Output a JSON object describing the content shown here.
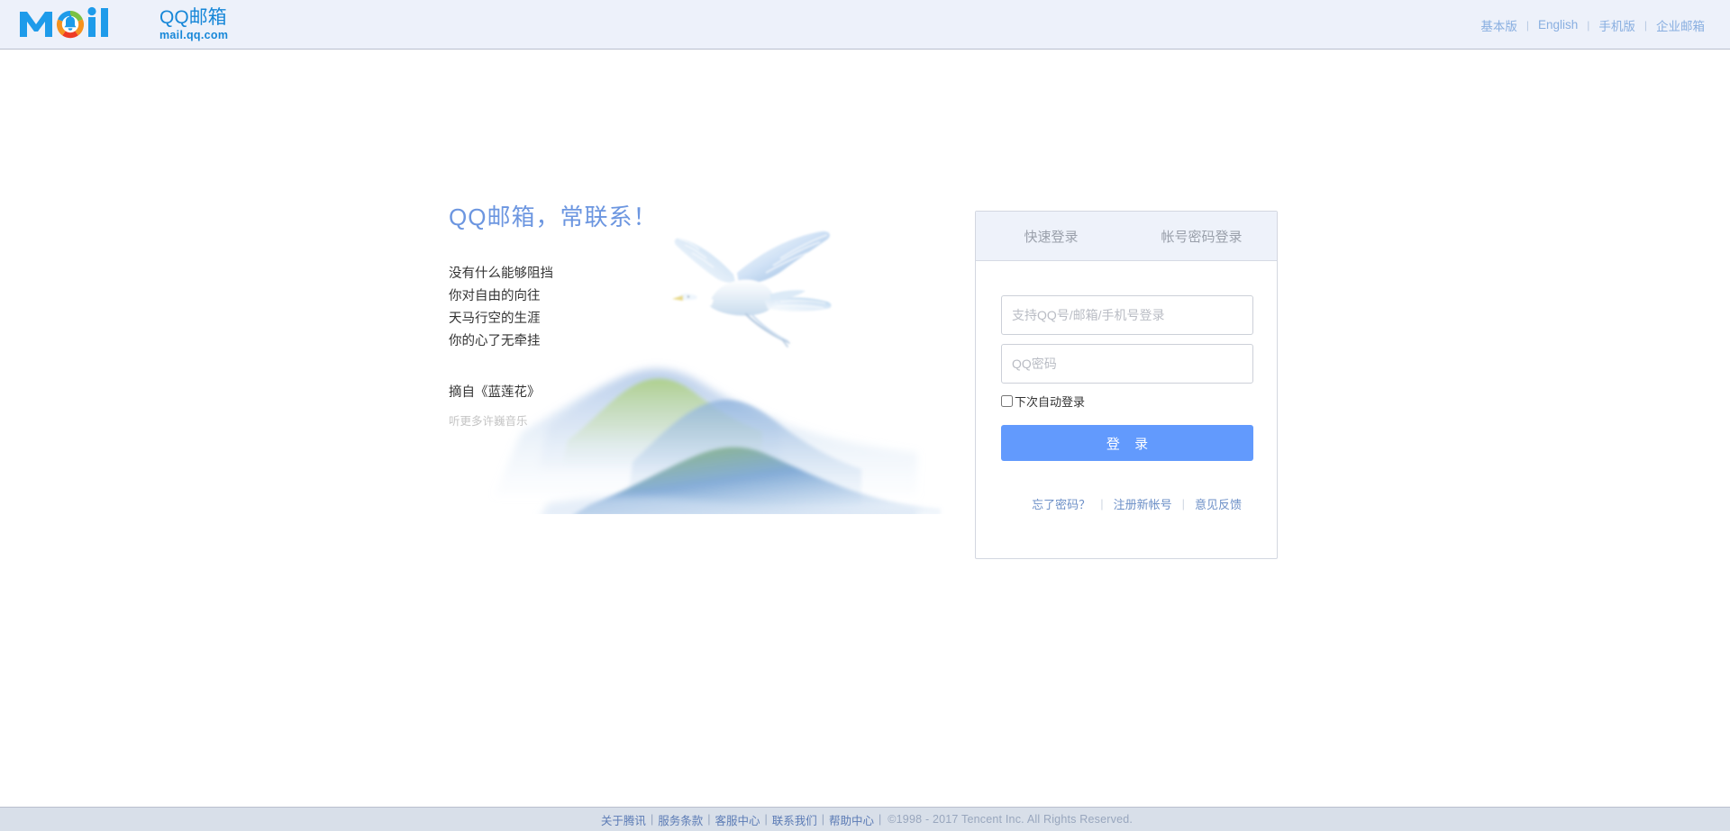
{
  "header": {
    "logo": {
      "mark_icon": "qqmail-logo-icon",
      "wordmark": "Mail",
      "title": "QQ邮箱",
      "subtitle": "mail.qq.com"
    },
    "links": [
      {
        "label": "基本版"
      },
      {
        "label": "English"
      },
      {
        "label": "手机版"
      },
      {
        "label": "企业邮箱"
      }
    ],
    "separator": "|",
    "bg_color": "#edf1fa",
    "link_color": "#88aee0"
  },
  "promo": {
    "title": "QQ邮箱，常联系！",
    "title_color": "#6c96e0",
    "lines": [
      "没有什么能够阻挡",
      "你对自由的向往",
      "天马行空的生涯",
      "你的心了无牵挂"
    ],
    "source": "摘自《蓝莲花》",
    "music_link": "听更多许巍音乐",
    "art": {
      "crane_icon": "flying-crane-icon",
      "mountains_icon": "watercolor-mountains-icon"
    }
  },
  "login": {
    "tabs": [
      {
        "label": "快速登录",
        "active": true
      },
      {
        "label": "帐号密码登录",
        "active": false
      }
    ],
    "account": {
      "value": "",
      "placeholder": "支持QQ号/邮箱/手机号登录"
    },
    "password": {
      "value": "",
      "placeholder": "QQ密码"
    },
    "remember": {
      "label": "下次自动登录",
      "checked": false
    },
    "submit_label": "登  录",
    "submit_color": "#629afd",
    "links": [
      {
        "label": "忘了密码？"
      },
      {
        "label": "注册新帐号"
      },
      {
        "label": "意见反馈"
      }
    ],
    "separator": "|"
  },
  "footer": {
    "links": [
      {
        "label": "关于腾讯"
      },
      {
        "label": "服务条款"
      },
      {
        "label": "客服中心"
      },
      {
        "label": "联系我们"
      },
      {
        "label": "帮助中心"
      }
    ],
    "separator": "|",
    "copyright": "©1998 - 2017 Tencent Inc. All Rights Reserved.",
    "bg_color": "#d8dfe9"
  }
}
